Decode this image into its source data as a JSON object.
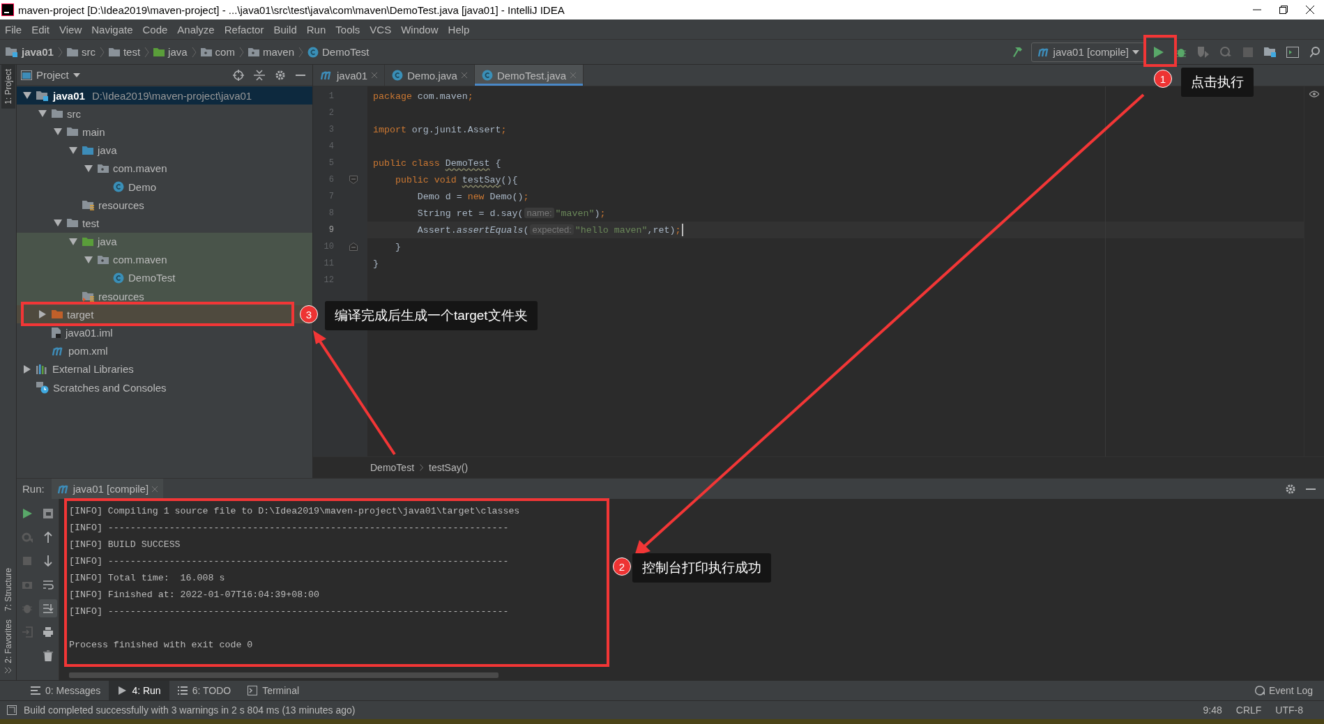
{
  "window": {
    "title": "maven-project [D:\\Idea2019\\maven-project] - ...\\java01\\src\\test\\java\\com\\maven\\DemoTest.java [java01] - IntelliJ IDEA"
  },
  "menu": [
    "File",
    "Edit",
    "View",
    "Navigate",
    "Code",
    "Analyze",
    "Refactor",
    "Build",
    "Run",
    "Tools",
    "VCS",
    "Window",
    "Help"
  ],
  "breadcrumb": [
    {
      "label": "java01",
      "kind": "module"
    },
    {
      "label": "src",
      "kind": "folder"
    },
    {
      "label": "test",
      "kind": "folder"
    },
    {
      "label": "java",
      "kind": "test-source"
    },
    {
      "label": "com",
      "kind": "package"
    },
    {
      "label": "maven",
      "kind": "package"
    },
    {
      "label": "DemoTest",
      "kind": "class"
    }
  ],
  "run_configuration": "java01 [compile]",
  "side_tabs": [
    {
      "label": "1: Project",
      "selected": true
    },
    {
      "label": "7: Structure",
      "selected": false
    },
    {
      "label": "2: Favorites",
      "selected": false
    }
  ],
  "project_panel": {
    "title": "Project",
    "tree": [
      {
        "label": "java01",
        "path": "D:\\Idea2019\\maven-project\\java01",
        "kind": "module",
        "expanded": true,
        "selected": true,
        "children": [
          {
            "label": "src",
            "kind": "folder",
            "expanded": true,
            "selected": false,
            "children": [
              {
                "label": "main",
                "kind": "folder",
                "expanded": true,
                "selected": false,
                "children": [
                  {
                    "label": "java",
                    "kind": "source",
                    "expanded": true,
                    "selected": false,
                    "children": [
                      {
                        "label": "com.maven",
                        "kind": "package",
                        "expanded": true,
                        "selected": false,
                        "children": [
                          {
                            "label": "Demo",
                            "kind": "class",
                            "selected": false
                          }
                        ]
                      }
                    ]
                  },
                  {
                    "label": "resources",
                    "kind": "resources",
                    "selected": false
                  }
                ]
              },
              {
                "label": "test",
                "kind": "folder",
                "expanded": true,
                "selected": false,
                "children": [
                  {
                    "label": "java",
                    "kind": "test-source",
                    "expanded": true,
                    "selected": false,
                    "color": "#49544a",
                    "children": [
                      {
                        "label": "com.maven",
                        "kind": "package",
                        "expanded": true,
                        "selected": false,
                        "color": "#49544a",
                        "children": [
                          {
                            "label": "DemoTest",
                            "kind": "class",
                            "selected": false,
                            "color": "#49544a"
                          }
                        ]
                      }
                    ]
                  },
                  {
                    "label": "resources",
                    "kind": "test-resources",
                    "selected": false,
                    "color": "#49544a"
                  }
                ]
              }
            ]
          },
          {
            "label": "target",
            "kind": "excluded",
            "expanded": false,
            "selected": false,
            "color": "#4f4a3e"
          },
          {
            "label": "java01.iml",
            "kind": "iml",
            "selected": false
          },
          {
            "label": "pom.xml",
            "kind": "maven",
            "selected": false
          }
        ]
      },
      {
        "label": "External Libraries",
        "kind": "libraries",
        "expanded": false,
        "selected": false
      },
      {
        "label": "Scratches and Consoles",
        "kind": "scratches",
        "selected": false
      }
    ]
  },
  "editor": {
    "tabs": [
      {
        "label": "java01",
        "kind": "maven",
        "selected": false
      },
      {
        "label": "Demo.java",
        "kind": "class",
        "selected": false
      },
      {
        "label": "DemoTest.java",
        "kind": "class",
        "selected": true
      }
    ],
    "lines": [
      {
        "number": "1",
        "current": false,
        "tokens": [
          {
            "kind": "kw",
            "text": "package"
          },
          {
            "kind": "plain",
            "text": " com.maven"
          },
          {
            "kind": "punct",
            "text": ";"
          }
        ]
      },
      {
        "number": "2",
        "current": false
      },
      {
        "number": "3",
        "current": false,
        "tokens": [
          {
            "kind": "kw",
            "text": "import"
          },
          {
            "kind": "plain",
            "text": " org.junit.Assert"
          },
          {
            "kind": "punct",
            "text": ";"
          }
        ]
      },
      {
        "number": "4",
        "current": false
      },
      {
        "number": "5",
        "current": false,
        "tokens": [
          {
            "kind": "kw",
            "text": "public class "
          },
          {
            "kind": "warn",
            "text": "DemoTest"
          },
          {
            "kind": "plain",
            "text": " {"
          }
        ]
      },
      {
        "number": "6",
        "current": false,
        "fold_start": true,
        "tokens": [
          {
            "kind": "kw",
            "text": "    public void "
          },
          {
            "kind": "warn",
            "text": "testSay"
          },
          {
            "kind": "plain",
            "text": "(){"
          }
        ]
      },
      {
        "number": "7",
        "current": false,
        "tokens": [
          {
            "kind": "plain",
            "text": "        Demo d = "
          },
          {
            "kind": "kw",
            "text": "new"
          },
          {
            "kind": "plain",
            "text": " Demo()"
          },
          {
            "kind": "punct",
            "text": ";"
          }
        ]
      },
      {
        "number": "8",
        "current": false,
        "tokens": [
          {
            "kind": "plain",
            "text": "        String ret = d.say("
          },
          {
            "kind": "hint",
            "text": "name:"
          },
          {
            "kind": "str",
            "text": "\"maven\""
          },
          {
            "kind": "plain",
            "text": ")"
          },
          {
            "kind": "punct",
            "text": ";"
          }
        ]
      },
      {
        "number": "9",
        "current": true,
        "tokens": [
          {
            "kind": "plain",
            "text": "        Assert."
          },
          {
            "kind": "method",
            "text": "assertEquals"
          },
          {
            "kind": "plain",
            "text": "("
          },
          {
            "kind": "hint",
            "text": "expected:"
          },
          {
            "kind": "str",
            "text": "\"hello maven\""
          },
          {
            "kind": "plain",
            "text": ",ret)"
          },
          {
            "kind": "punct",
            "text": ";"
          }
        ]
      },
      {
        "number": "10",
        "current": false,
        "fold_end": true,
        "tokens": [
          {
            "kind": "plain",
            "text": "    }"
          }
        ]
      },
      {
        "number": "11",
        "current": false,
        "tokens": [
          {
            "kind": "plain",
            "text": "}"
          }
        ]
      },
      {
        "number": "12",
        "current": false
      }
    ],
    "breadcrumb": [
      "DemoTest",
      "testSay()"
    ]
  },
  "run_panel": {
    "label": "Run:",
    "tab": "java01 [compile]",
    "console": [
      "[INFO] Compiling 1 source file to D:\\Idea2019\\maven-project\\java01\\target\\classes",
      "[INFO] ------------------------------------------------------------------------",
      "[INFO] BUILD SUCCESS",
      "[INFO] ------------------------------------------------------------------------",
      "[INFO] Total time:  16.008 s",
      "[INFO] Finished at: 2022-01-07T16:04:39+08:00",
      "[INFO] ------------------------------------------------------------------------"
    ],
    "footer": "Process finished with exit code 0"
  },
  "tool_tabs": [
    {
      "label": "0: Messages",
      "kind": "messages",
      "selected": false
    },
    {
      "label": "4: Run",
      "kind": "run",
      "selected": true
    },
    {
      "label": "6: TODO",
      "kind": "todo",
      "selected": false
    },
    {
      "label": "Terminal",
      "kind": "terminal",
      "selected": false
    }
  ],
  "event_log": "Event Log",
  "status_bar": {
    "message": "Build completed successfully with 3 warnings in 2 s 804 ms (13 minutes ago)",
    "position": "9:48",
    "line_separator": "CRLF",
    "encoding": "UTF-8"
  },
  "annotations": [
    {
      "number": "1",
      "text": "点击执行"
    },
    {
      "number": "2",
      "text": "控制台打印执行成功"
    },
    {
      "number": "3",
      "text": "编译完成后生成一个target文件夹"
    }
  ]
}
